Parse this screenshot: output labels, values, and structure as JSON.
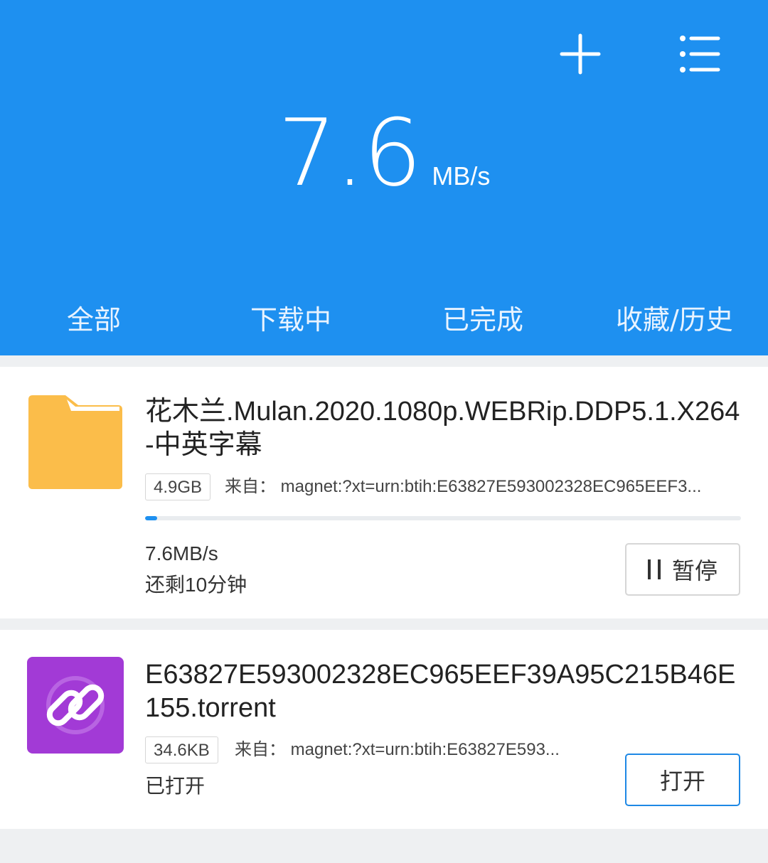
{
  "header": {
    "speed_value": "7.6",
    "speed_unit": "MB/s",
    "icons": [
      "add-icon",
      "menu-list-icon"
    ],
    "background_color": "#1e90f0"
  },
  "tabs": [
    {
      "label": "全部"
    },
    {
      "label": "下载中"
    },
    {
      "label": "已完成"
    },
    {
      "label": "收藏/历史"
    }
  ],
  "tasks": [
    {
      "icon": "folder-icon",
      "title": "花木兰.Mulan.2020.1080p.WEBRip.DDP5.1.X264-中英字幕",
      "size": "4.9GB",
      "source": "来自： magnet:?xt=urn:btih:E63827E593002328EC965EEF3...",
      "progress": 0.02,
      "speed": "7.6MB/s",
      "remaining": "还剩10分钟",
      "action": "暂停"
    },
    {
      "icon": "link-icon",
      "title": "E63827E593002328EC965EEF39A95C215B46E155.torrent",
      "size": "34.6KB",
      "source": "来自： magnet:?xt=urn:btih:E63827E593...",
      "status": "已打开",
      "action": "打开"
    }
  ]
}
